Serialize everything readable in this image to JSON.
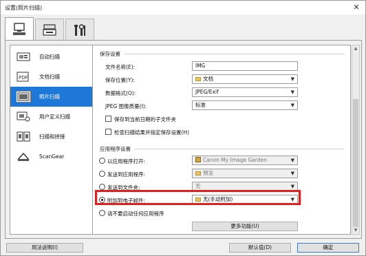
{
  "window": {
    "title": "设置(照片扫描)",
    "close_glyph": "✕"
  },
  "tabs": [
    {
      "icon": "scan-from-computer-icon"
    },
    {
      "icon": "scan-from-panel-icon"
    },
    {
      "icon": "tools-icon"
    }
  ],
  "sidebar": {
    "items": [
      {
        "label": "自动扫描",
        "icon": "auto-scan-icon"
      },
      {
        "label": "文档扫描",
        "icon": "document-scan-icon"
      },
      {
        "label": "照片扫描",
        "icon": "photo-scan-icon",
        "selected": true
      },
      {
        "label": "用户定义扫描",
        "icon": "custom-scan-icon"
      },
      {
        "label": "扫描和拼接",
        "icon": "stitch-scan-icon"
      },
      {
        "label": "ScanGear",
        "icon": "scangear-icon"
      }
    ]
  },
  "save_settings": {
    "group_title": "保存设置",
    "file_name_label": "文件名称(E):",
    "file_name_value": "IMG",
    "save_in_label": "保存位置(Y):",
    "save_in_value": "文档",
    "data_format_label": "数据格式(O):",
    "data_format_value": "JPEG/Exif",
    "jpeg_quality_label": "JPEG 图像质量(I):",
    "jpeg_quality_value": "标准",
    "subfolder_checkbox": "保存到当前日期的子文件夹",
    "check_results_checkbox": "检查扫描结果并指定保存设置(H)"
  },
  "app_settings": {
    "group_title": "应用程序设置",
    "open_with_label": "以应用程序打开:",
    "open_with_value": "Canon My Image Garden",
    "send_to_app_label": "发送到应用程序:",
    "send_to_app_value": "预览",
    "send_to_folder_label": "发送到文件夹:",
    "send_to_folder_value": "无",
    "attach_email_label": "附加到电子邮件:",
    "attach_email_value": "无(手动附加)",
    "no_app_label": "请不要启动任何应用程序",
    "more_functions_button": "更多功能(U)"
  },
  "footer": {
    "instructions_button": "用法说明(I)",
    "defaults_button": "默认值(D)",
    "ok_button": "确定"
  },
  "colors": {
    "selection": "#1e78d7",
    "highlight_border": "#e01f1f"
  }
}
